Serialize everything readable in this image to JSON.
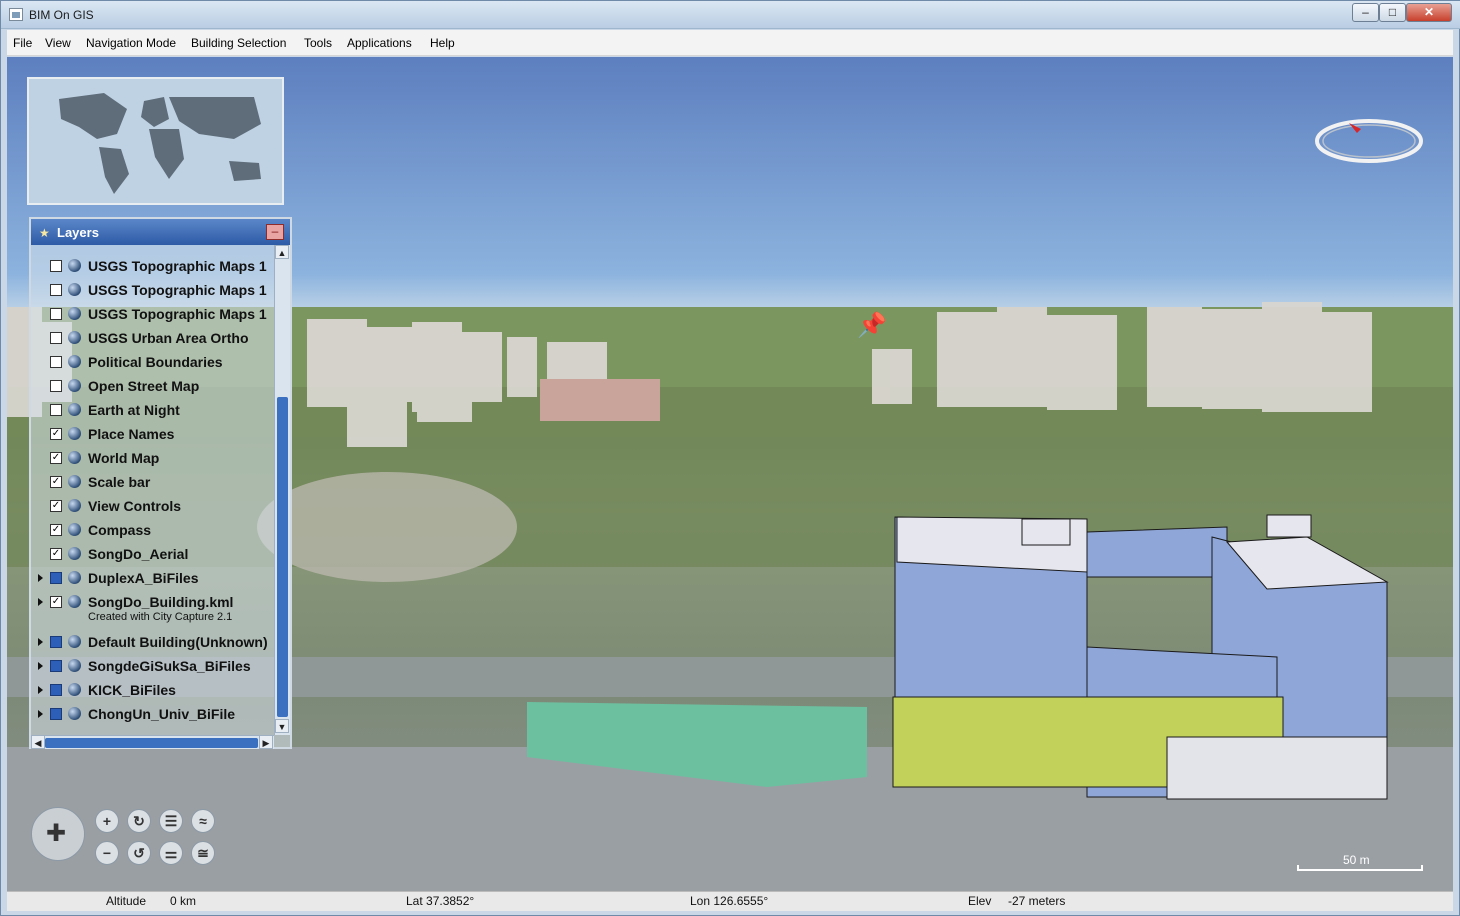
{
  "window": {
    "title": "BIM On GIS",
    "min_label": "–",
    "max_label": "□",
    "close_label": "✕"
  },
  "menu": [
    "File",
    "View",
    "Navigation Mode",
    "Building Selection",
    "Tools",
    "Applications",
    "Help"
  ],
  "layers_panel": {
    "title": "Layers",
    "minimize_label": "–",
    "items": [
      {
        "label": "USGS Topographic Maps 1",
        "checked": false,
        "blue": false,
        "expandable": false
      },
      {
        "label": "USGS Topographic Maps 1",
        "checked": false,
        "blue": false,
        "expandable": false
      },
      {
        "label": "USGS Topographic Maps 1",
        "checked": false,
        "blue": false,
        "expandable": false
      },
      {
        "label": "USGS Urban Area Ortho",
        "checked": false,
        "blue": false,
        "expandable": false
      },
      {
        "label": "Political Boundaries",
        "checked": false,
        "blue": false,
        "expandable": false
      },
      {
        "label": "Open Street Map",
        "checked": false,
        "blue": false,
        "expandable": false
      },
      {
        "label": "Earth at Night",
        "checked": false,
        "blue": false,
        "expandable": false
      },
      {
        "label": "Place Names",
        "checked": true,
        "blue": false,
        "expandable": false
      },
      {
        "label": "World Map",
        "checked": true,
        "blue": false,
        "expandable": false
      },
      {
        "label": "Scale bar",
        "checked": true,
        "blue": false,
        "expandable": false
      },
      {
        "label": "View Controls",
        "checked": true,
        "blue": false,
        "expandable": false
      },
      {
        "label": "Compass",
        "checked": true,
        "blue": false,
        "expandable": false
      },
      {
        "label": "SongDo_Aerial",
        "checked": true,
        "blue": false,
        "expandable": false
      },
      {
        "label": "DuplexA_BiFiles",
        "checked": false,
        "blue": true,
        "expandable": true
      },
      {
        "label": "SongDo_Building.kml",
        "checked": true,
        "blue": false,
        "expandable": true,
        "sub": "Created with City Capture 2.1"
      },
      {
        "label": "Default Building(Unknown)",
        "checked": false,
        "blue": true,
        "expandable": true
      },
      {
        "label": "SongdeGiSukSa_BiFiles",
        "checked": false,
        "blue": true,
        "expandable": true
      },
      {
        "label": "KICK_BiFiles",
        "checked": false,
        "blue": true,
        "expandable": true
      },
      {
        "label": "ChongUn_Univ_BiFile",
        "checked": false,
        "blue": true,
        "expandable": true
      }
    ]
  },
  "scale_bar": {
    "label": "50 m"
  },
  "status": {
    "altitude_label": "Altitude",
    "altitude_value": "0 km",
    "lat": "Lat 37.3852°",
    "lon": "Lon 126.6555°",
    "elev_label": "Elev",
    "elev_value": "-27 meters"
  },
  "colors": {
    "title_bg": "#c9d9ea",
    "layers_header": "#3b68b2",
    "building_facade": "#8fa6d8",
    "sky": "#7da4d6",
    "ground": "#6d8a55"
  }
}
